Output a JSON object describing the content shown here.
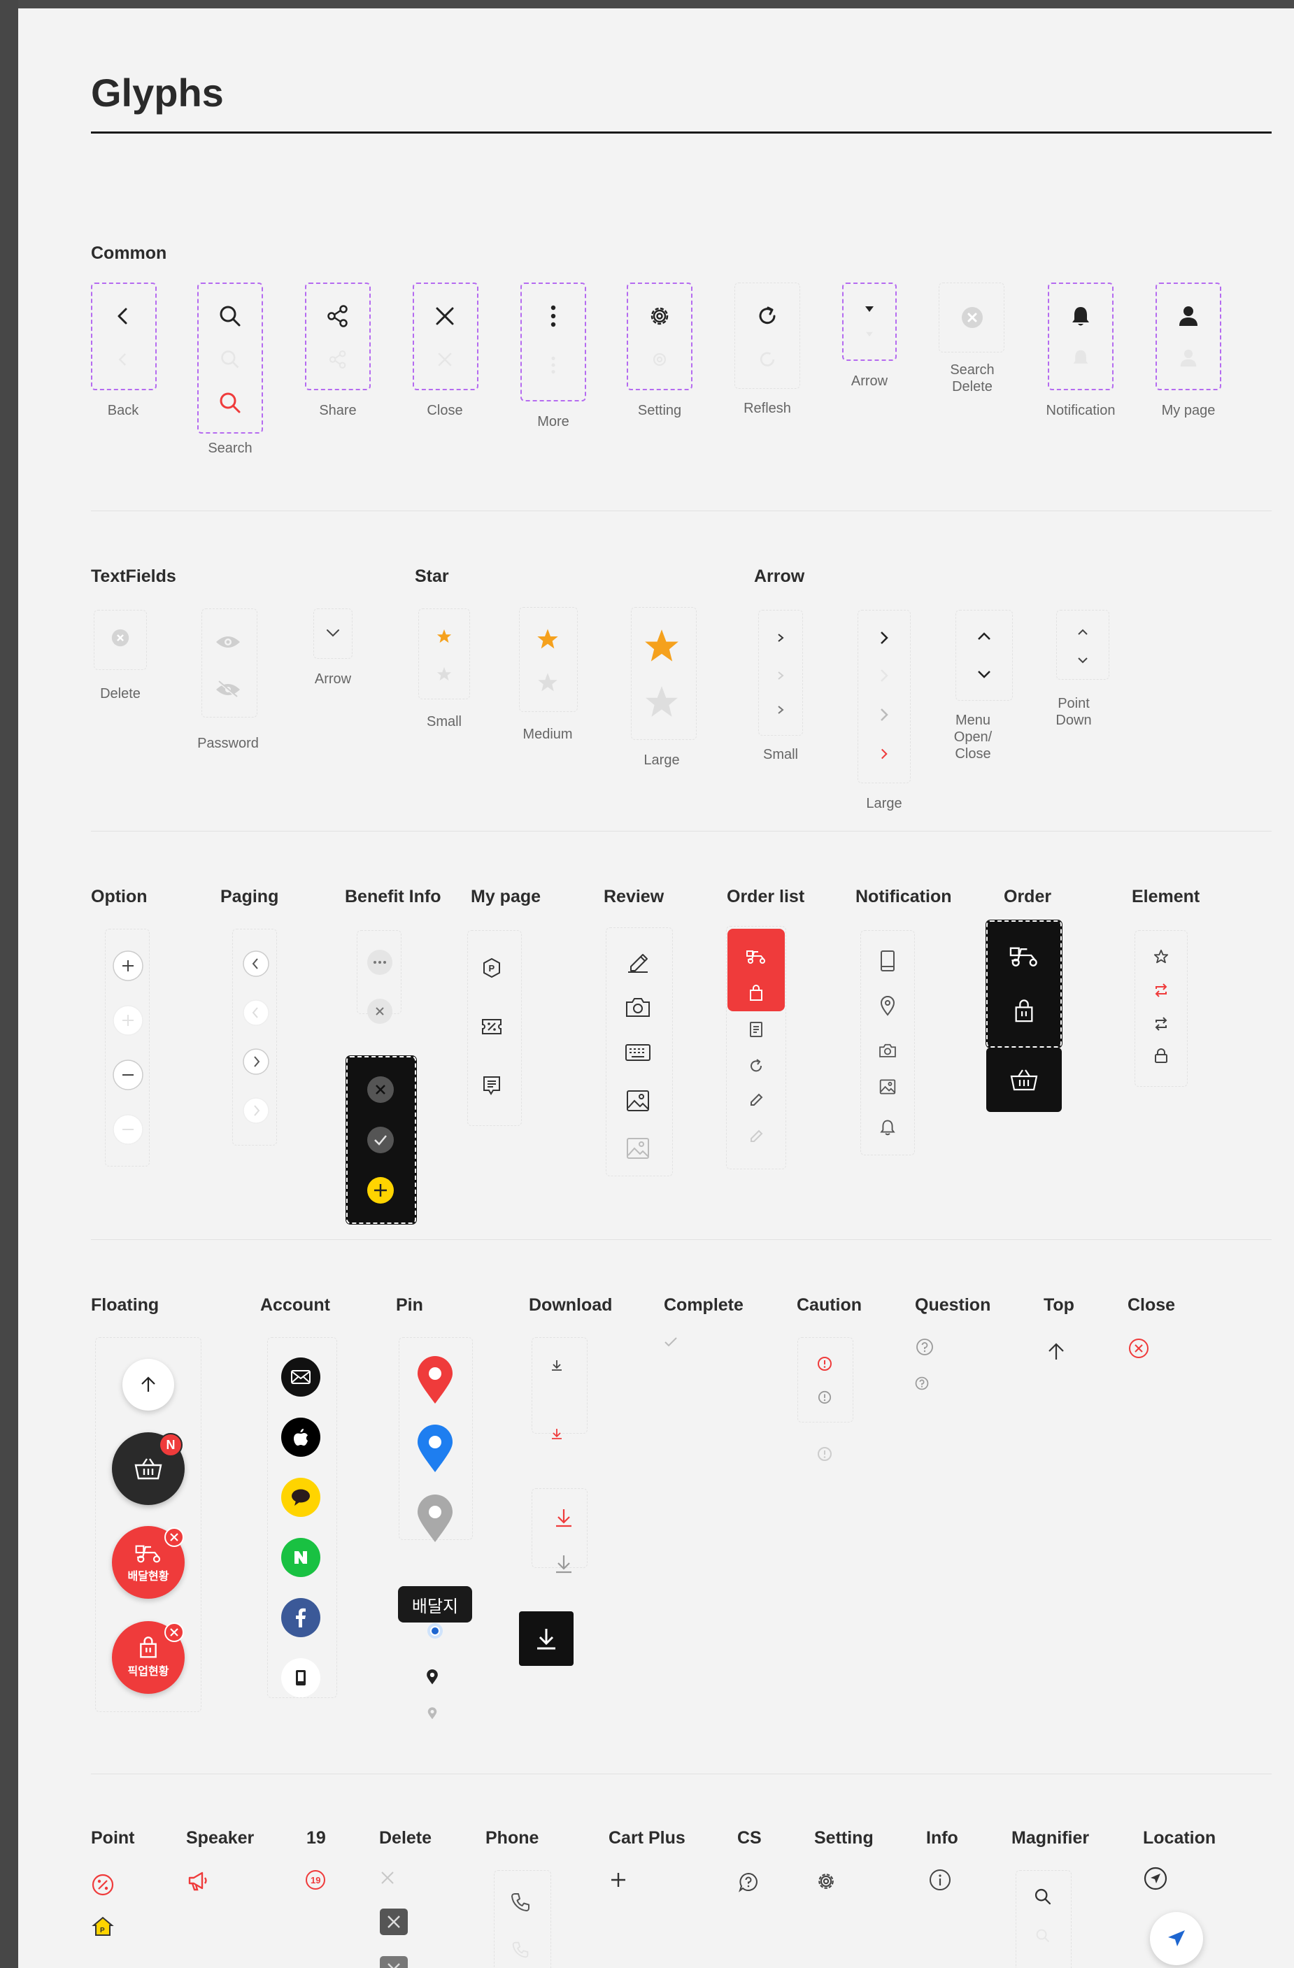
{
  "page": {
    "title": "Glyphs"
  },
  "sections": {
    "common": "Common",
    "textfields": "TextFields",
    "star": "Star",
    "arrow": "Arrow",
    "option": "Option",
    "paging": "Paging",
    "benefit_info": "Benefit Info",
    "my_page": "My page",
    "review": "Review",
    "order_list": "Order list",
    "notification": "Notification",
    "order": "Order",
    "element": "Element",
    "floating": "Floating",
    "account": "Account",
    "pin": "Pin",
    "download": "Download",
    "complete": "Complete",
    "caution": "Caution",
    "question": "Question",
    "top": "Top",
    "close": "Close",
    "point": "Point",
    "speaker": "Speaker",
    "nineteen": "19",
    "delete": "Delete",
    "phone": "Phone",
    "cart_plus": "Cart Plus",
    "cs": "CS",
    "setting": "Setting",
    "info": "Info",
    "magnifier": "Magnifier",
    "location": "Location"
  },
  "common_labels": {
    "back": "Back",
    "search": "Search",
    "share": "Share",
    "close": "Close",
    "more": "More",
    "setting": "Setting",
    "refresh": "Reflesh",
    "arrow": "Arrow",
    "search_delete": "Search\nDelete",
    "notification": "Notification",
    "my_page": "My page"
  },
  "textfield_labels": {
    "delete": "Delete",
    "password": "Password",
    "arrow": "Arrow"
  },
  "star_labels": {
    "small": "Small",
    "medium": "Medium",
    "large": "Large"
  },
  "arrow_labels": {
    "small": "Small",
    "large": "Large",
    "menu": "Menu\nOpen/\nClose",
    "point_down": "Point\nDown"
  },
  "floating": {
    "badge_new": "N",
    "delivery_label": "배달현황",
    "pickup_label": "픽업현황"
  },
  "pin": {
    "tooltip": "배달지"
  },
  "nineteen_icon_text": "19",
  "colors": {
    "accent_red": "#ef3b3b",
    "star_orange": "#f5a11d",
    "pin_blue": "#1e7ef0",
    "kakao_yellow": "#ffd400",
    "naver_green": "#19c142",
    "facebook_blue": "#3b5998",
    "dashed_purple": "#b56bf0"
  }
}
